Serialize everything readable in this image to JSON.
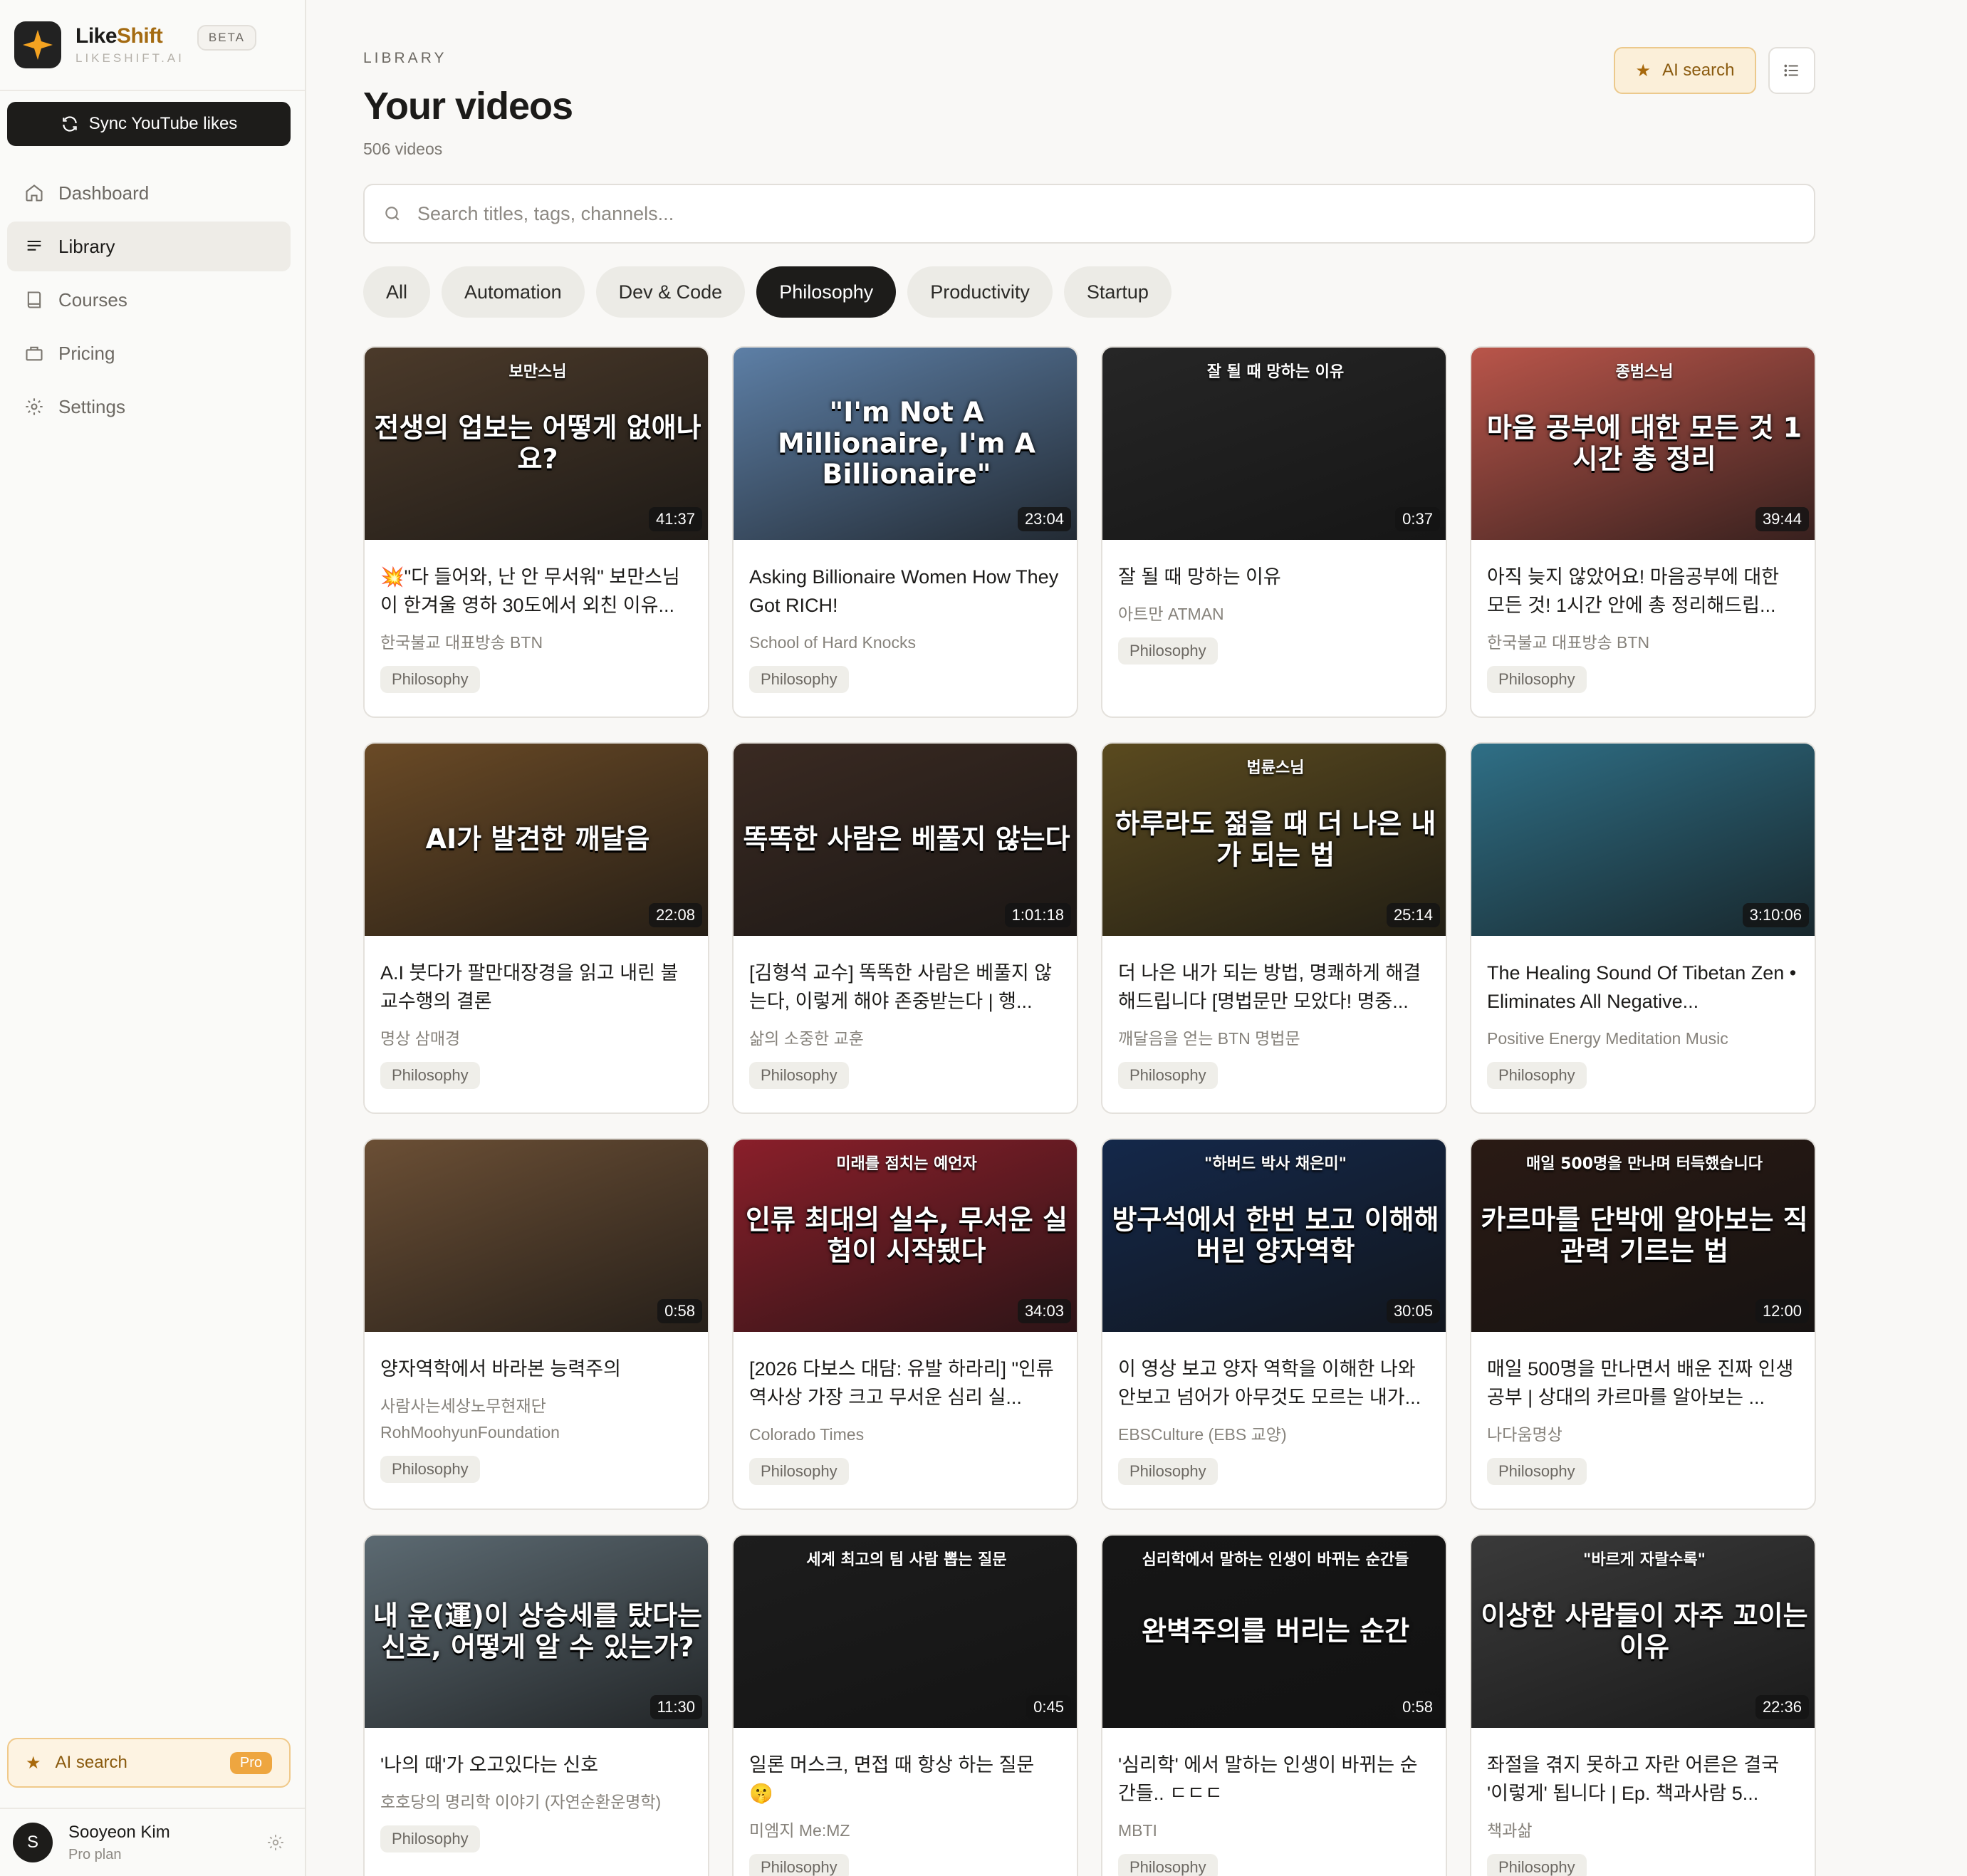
{
  "brand": {
    "name_a": "Like",
    "name_b": "Shift",
    "domain": "LIKESHIFT.AI",
    "beta": "BETA"
  },
  "sidebar": {
    "sync_label": "Sync YouTube likes",
    "items": [
      {
        "label": "Dashboard",
        "icon": "home-icon",
        "active": false
      },
      {
        "label": "Library",
        "icon": "list-icon",
        "active": true
      },
      {
        "label": "Courses",
        "icon": "book-icon",
        "active": false
      },
      {
        "label": "Pricing",
        "icon": "bag-icon",
        "active": false
      },
      {
        "label": "Settings",
        "icon": "gear-icon",
        "active": false
      }
    ],
    "ai_search": {
      "label": "AI search",
      "badge": "Pro"
    },
    "user": {
      "initial": "S",
      "name": "Sooyeon Kim",
      "plan": "Pro plan"
    }
  },
  "header": {
    "eyebrow": "LIBRARY",
    "title": "Your videos",
    "count": "506 videos",
    "ai_search_label": "AI search"
  },
  "search": {
    "placeholder": "Search titles, tags, channels..."
  },
  "filters": [
    {
      "label": "All",
      "active": false
    },
    {
      "label": "Automation",
      "active": false
    },
    {
      "label": "Dev & Code",
      "active": false
    },
    {
      "label": "Philosophy",
      "active": true
    },
    {
      "label": "Productivity",
      "active": false
    },
    {
      "label": "Startup",
      "active": false
    }
  ],
  "videos": [
    {
      "title": "💥\"다 들어와, 난 안 무서워\" 보만스님이 한겨울 영하 30도에서 외친 이유...",
      "channel": "한국불교 대표방송 BTN",
      "tag": "Philosophy",
      "duration": "41:37",
      "thumb_text": "전생의 업보는 어떻게 없애나요?",
      "thumb_sub": "보만스님",
      "bg": "#4b3a2a"
    },
    {
      "title": "Asking Billionaire Women How They Got RICH!",
      "channel": "School of Hard Knocks",
      "tag": "Philosophy",
      "duration": "23:04",
      "thumb_text": "\"I'm Not A Millionaire, I'm A Billionaire\"",
      "thumb_sub": "",
      "bg": "#5d7fa6"
    },
    {
      "title": "잘 될 때 망하는 이유",
      "channel": "아트만 ATMAN",
      "tag": "Philosophy",
      "duration": "0:37",
      "thumb_text": "",
      "thumb_sub": "잘 될 때 망하는 이유",
      "bg": "#262626"
    },
    {
      "title": "아직 늦지 않았어요! 마음공부에 대한 모든 것! 1시간 안에 총 정리해드립...",
      "channel": "한국불교 대표방송 BTN",
      "tag": "Philosophy",
      "duration": "39:44",
      "thumb_text": "마음 공부에 대한 모든 것 1시간 총 정리",
      "thumb_sub": "종범스님",
      "bg": "#b9554a"
    },
    {
      "title": "A.I 붓다가 팔만대장경을 읽고 내린 불교수행의 결론",
      "channel": "명상 삼매경",
      "tag": "Philosophy",
      "duration": "22:08",
      "thumb_text": "AI가 발견한 깨달음",
      "thumb_sub": "",
      "bg": "#6a4a26"
    },
    {
      "title": "[김형석 교수] 똑똑한 사람은 베풀지 않는다, 이렇게 해야 존중받는다 | 행...",
      "channel": "삶의 소중한 교훈",
      "tag": "Philosophy",
      "duration": "1:01:18",
      "thumb_text": "똑똑한 사람은 베풀지 않는다",
      "thumb_sub": "",
      "bg": "#3a2a22"
    },
    {
      "title": "더 나은 내가 되는 방법, 명쾌하게 해결해드립니다 [명법문만 모았다! 명중...",
      "channel": "깨달음을 얻는 BTN 명법문",
      "tag": "Philosophy",
      "duration": "25:14",
      "thumb_text": "하루라도 젊을 때 더 나은 내가 되는 법",
      "thumb_sub": "법륜스님",
      "bg": "#5a4a1f"
    },
    {
      "title": "The Healing Sound Of Tibetan Zen • Eliminates All Negative...",
      "channel": "Positive Energy Meditation Music",
      "tag": "Philosophy",
      "duration": "3:10:06",
      "thumb_text": "",
      "thumb_sub": "",
      "bg": "#2f6f86"
    },
    {
      "title": "양자역학에서 바라본 능력주의",
      "channel": "사람사는세상노무현재단 RohMoohyunFoundation",
      "tag": "Philosophy",
      "duration": "0:58",
      "thumb_text": "",
      "thumb_sub": "",
      "bg": "#6b4f35"
    },
    {
      "title": "[2026 다보스 대담: 유발 하라리] \"인류 역사상 가장 크고 무서운 심리 실...",
      "channel": "Colorado Times",
      "tag": "Philosophy",
      "duration": "34:03",
      "thumb_text": "인류 최대의 실수, 무서운 실험이 시작됐다",
      "thumb_sub": "미래를 점치는 예언자",
      "bg": "#8a1f2a"
    },
    {
      "title": "이 영상 보고 양자 역학을 이해한 나와 안보고 넘어가 아무것도 모르는 내가...",
      "channel": "EBSCulture (EBS 교양)",
      "tag": "Philosophy",
      "duration": "30:05",
      "thumb_text": "방구석에서 한번 보고 이해해버린 양자역학",
      "thumb_sub": "\"하버드 박사 채은미\"",
      "bg": "#14284a"
    },
    {
      "title": "매일 500명을 만나면서 배운 진짜 인생 공부 | 상대의 카르마를 알아보는 ...",
      "channel": "나다움명상",
      "tag": "Philosophy",
      "duration": "12:00",
      "thumb_text": "카르마를 단박에 알아보는 직관력 기르는 법",
      "thumb_sub": "매일 500명을 만나며 터득했습니다",
      "bg": "#2a1a14"
    },
    {
      "title": "'나의 때'가 오고있다는 신호",
      "channel": "호호당의 명리학 이야기 (자연순환운명학)",
      "tag": "Philosophy",
      "duration": "11:30",
      "thumb_text": "내 운(運)이 상승세를 탔다는 신호, 어떻게 알 수 있는가?",
      "thumb_sub": "",
      "bg": "#5c6a72"
    },
    {
      "title": "일론 머스크, 면접 때 항상 하는 질문 🤫",
      "channel": "미엠지 Me:MZ",
      "tag": "Philosophy",
      "duration": "0:45",
      "thumb_text": "",
      "thumb_sub": "세계 최고의 팀 사람 뽑는 질문",
      "bg": "#1d1d1d"
    },
    {
      "title": "'심리학' 에서 말하는 인생이 바뀌는 순간들.. ㄷㄷㄷ",
      "channel": "MBTI",
      "tag": "Philosophy",
      "duration": "0:58",
      "thumb_text": "완벽주의를 버리는 순간",
      "thumb_sub": "심리학에서 말하는 인생이 바뀌는 순간들",
      "bg": "#161616"
    },
    {
      "title": "좌절을 겪지 못하고 자란 어른은 결국 '이렇게' 됩니다 | Ep. 책과사람 5...",
      "channel": "책과삶",
      "tag": "Philosophy",
      "duration": "22:36",
      "thumb_text": "이상한 사람들이 자주 꼬이는 이유",
      "thumb_sub": "\"바르게 자랄수록\"",
      "bg": "#3a3a3a"
    }
  ]
}
